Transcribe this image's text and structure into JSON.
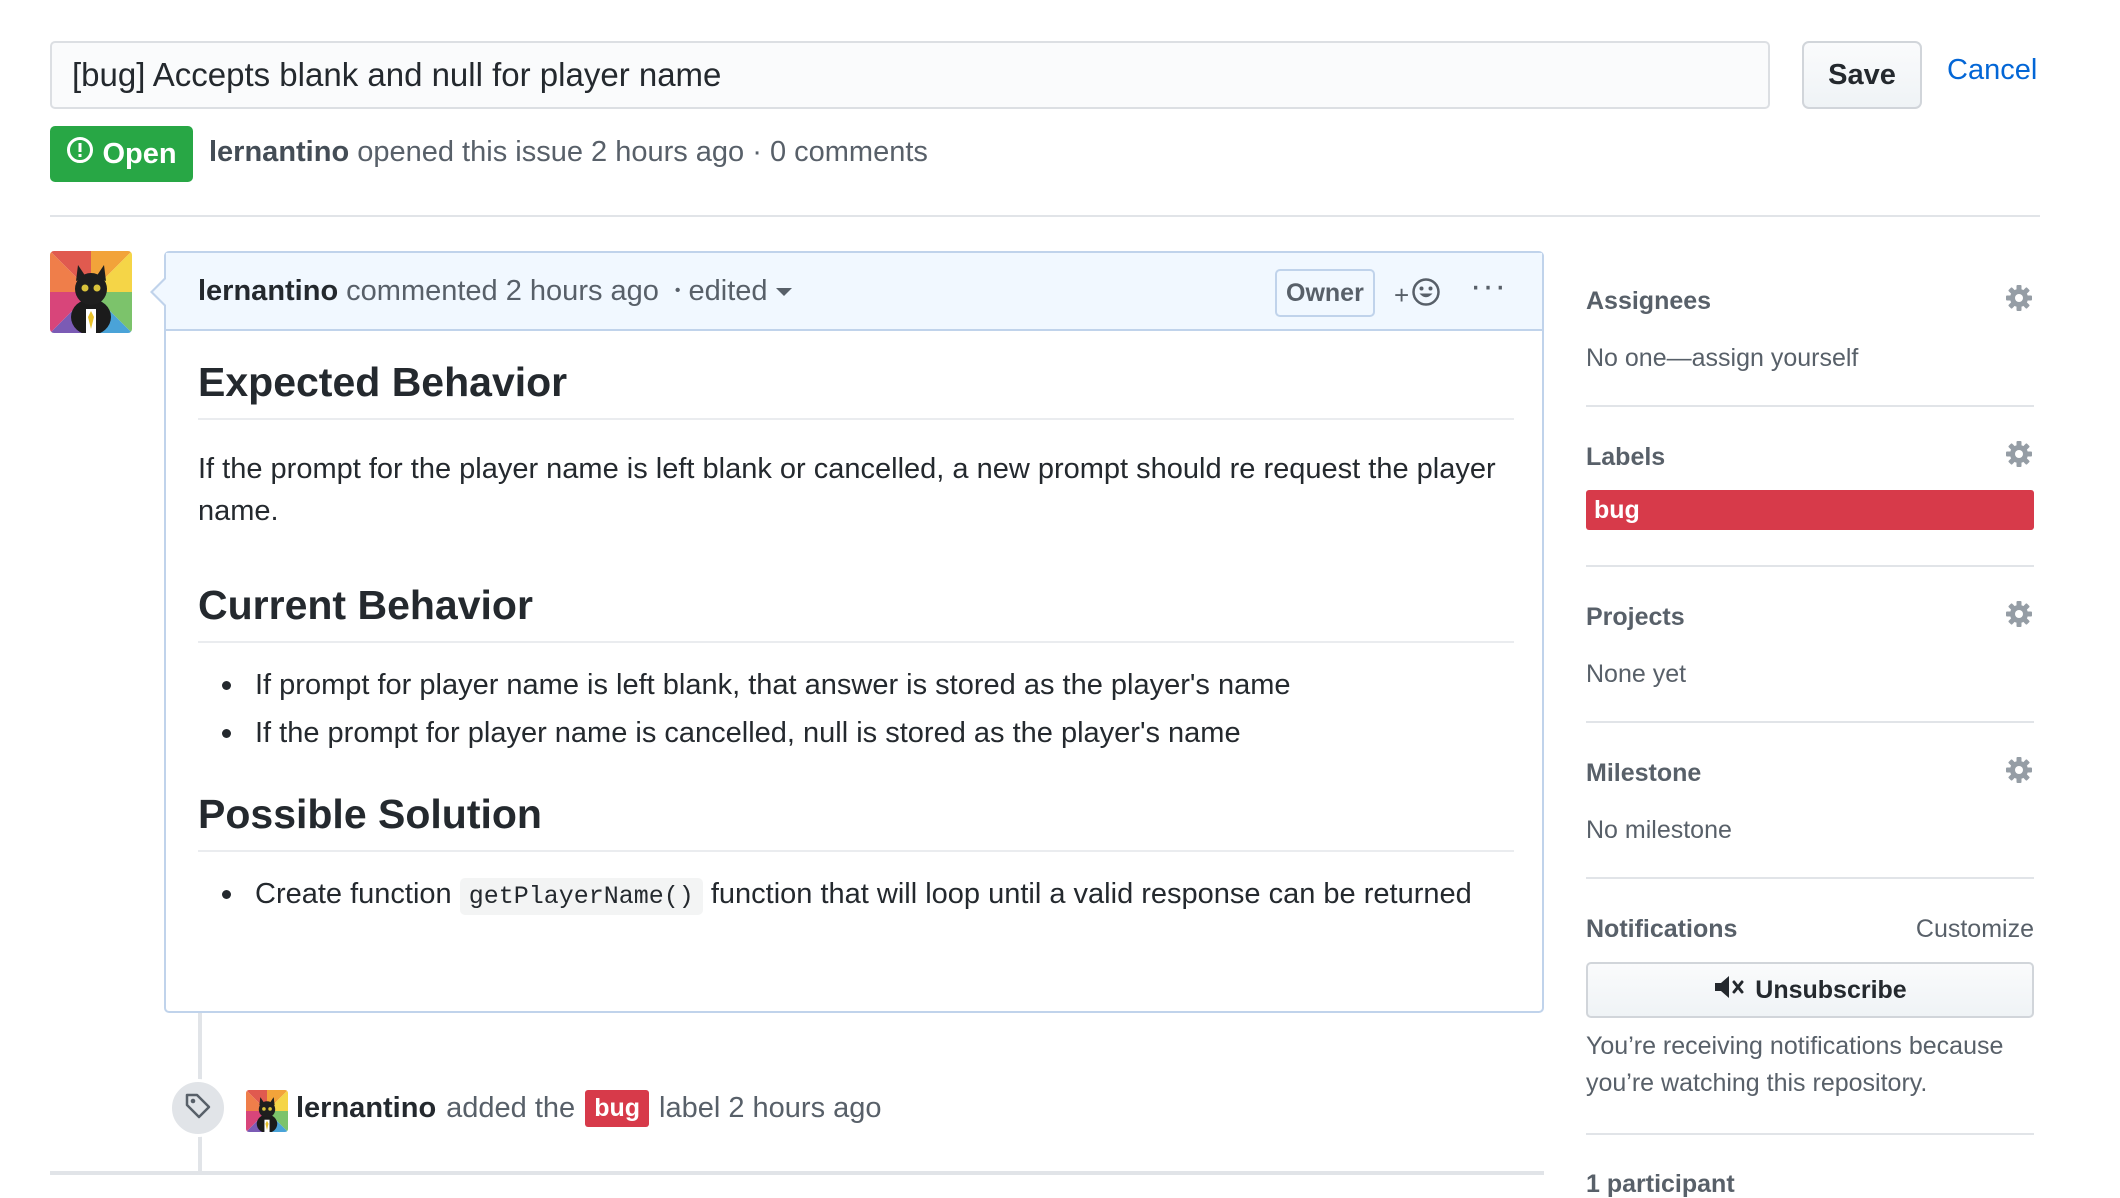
{
  "title_edit": {
    "value": "[bug] Accepts blank and null for player name",
    "save_label": "Save",
    "cancel_label": "Cancel"
  },
  "status": {
    "badge": "Open",
    "author": "lernantino",
    "meta": "opened this issue 2 hours ago · 0 comments"
  },
  "comment": {
    "author": "lernantino",
    "time": "commented 2 hours ago",
    "edited": "edited",
    "owner_badge": "Owner",
    "reaction_plus": "+",
    "more": "···",
    "body": {
      "h_expected": "Expected Behavior",
      "p_expected": "If the prompt for the player name is left blank or cancelled, a new prompt should re request the player name.",
      "h_current": "Current Behavior",
      "current_items": [
        "If prompt for player name is left blank, that answer is stored as the player's name",
        "If the prompt for player name is cancelled, null is stored as the player's name"
      ],
      "h_solution": "Possible Solution",
      "solution_pre": "Create function",
      "solution_code": "getPlayerName()",
      "solution_post": "function that will loop until a valid response can be returned"
    }
  },
  "timeline_event": {
    "author": "lernantino",
    "text_before": "added the",
    "label": "bug",
    "text_after": "label 2 hours ago"
  },
  "sidebar": {
    "assignees": {
      "title": "Assignees",
      "value": "No one—assign yourself"
    },
    "labels": {
      "title": "Labels",
      "label": "bug",
      "label_color": "#d73a4a"
    },
    "projects": {
      "title": "Projects",
      "value": "None yet"
    },
    "milestone": {
      "title": "Milestone",
      "value": "No milestone"
    },
    "notifications": {
      "title": "Notifications",
      "customize": "Customize",
      "button": "Unsubscribe",
      "reason": "You’re receiving notifications because you’re watching this repository."
    },
    "participants": {
      "title": "1 participant"
    }
  },
  "colors": {
    "open_green": "#28a745",
    "link_blue": "#0366d6",
    "bug_red": "#d73a4a",
    "comment_header_bg": "#f1f8ff"
  }
}
